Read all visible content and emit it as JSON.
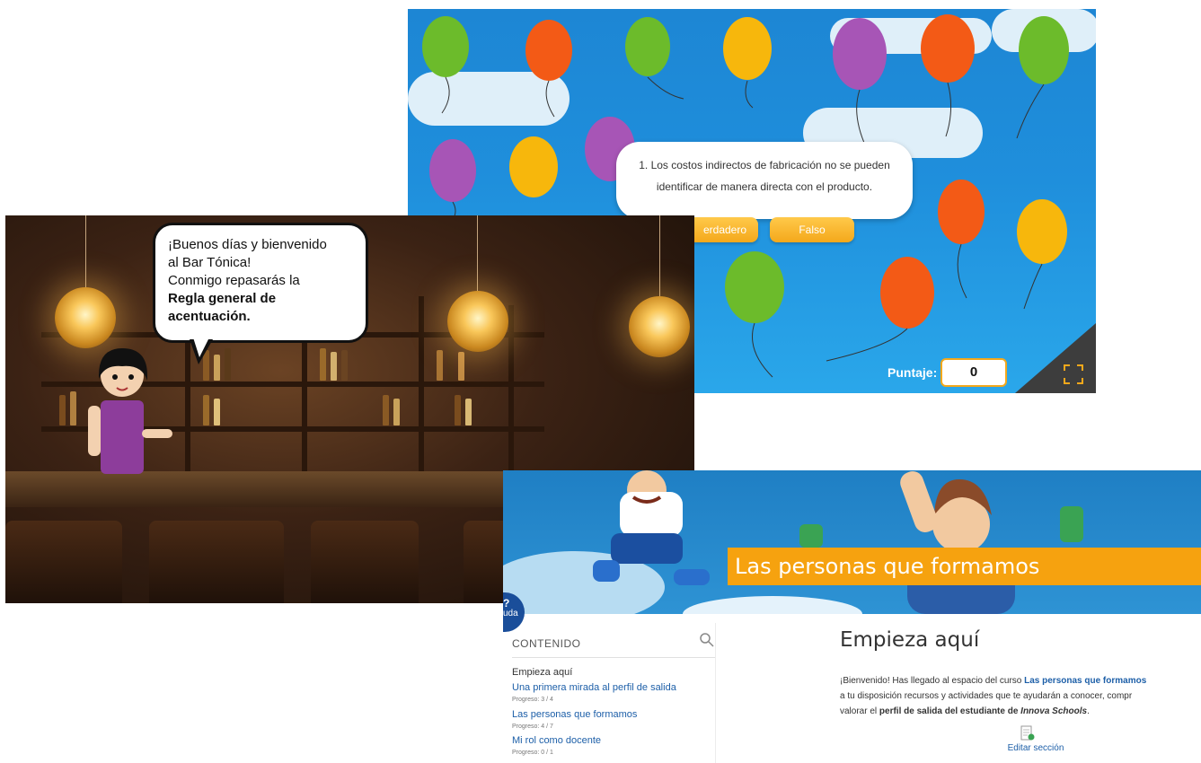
{
  "game": {
    "question": "1. Los costos indirectos de fabricación no se pueden identificar de manera directa con el producto.",
    "question_line1": "1. Los costos indirectos de fabricación no se pueden",
    "question_line2": "identificar de manera directa con el producto.",
    "true_label": "erdadero",
    "false_label": "Falso",
    "score_label": "Puntaje:",
    "score_value": "0",
    "fullscreen_icon": "fullscreen-icon",
    "colors": {
      "sky": "#1f8fdc",
      "button": "#f4a81b",
      "green": "#6cbb2b",
      "orange": "#f35a16",
      "yellow": "#f7b70c",
      "purple": "#a755b6"
    }
  },
  "bar": {
    "speech_line1": "¡Buenos días y bienvenido",
    "speech_line2": "al Bar Tónica!",
    "speech_line3": "Conmigo repasarás la",
    "speech_bold1": "Regla general de",
    "speech_bold2": "acentuación."
  },
  "course": {
    "banner_title": "Las personas que formamos",
    "help_label": "uda",
    "sidebar_title": "CONTENIDO",
    "search_icon": "search-icon",
    "nav": [
      {
        "label": "Empieza aquí",
        "progress": ""
      },
      {
        "label": "Una primera mirada al perfil de salida",
        "progress": "Progreso: 3 / 4"
      },
      {
        "label": "Las personas que formamos",
        "progress": "Progreso: 4 / 7"
      },
      {
        "label": "Mi rol como docente",
        "progress": "Progreso: 0 / 1"
      }
    ],
    "heading": "Empieza aquí",
    "intro_1": "¡Bienvenido! Has llegado al espacio del curso ",
    "intro_link": "Las personas que formamos",
    "intro_2": "a tu disposición recursos y actividades que te ayudarán a conocer, compr",
    "intro_3a": "valorar el ",
    "intro_3b": "perfil de salida del estudiante de ",
    "intro_3c": "Innova Schools",
    "intro_3d": ".",
    "edit_label": "Editar sección"
  }
}
